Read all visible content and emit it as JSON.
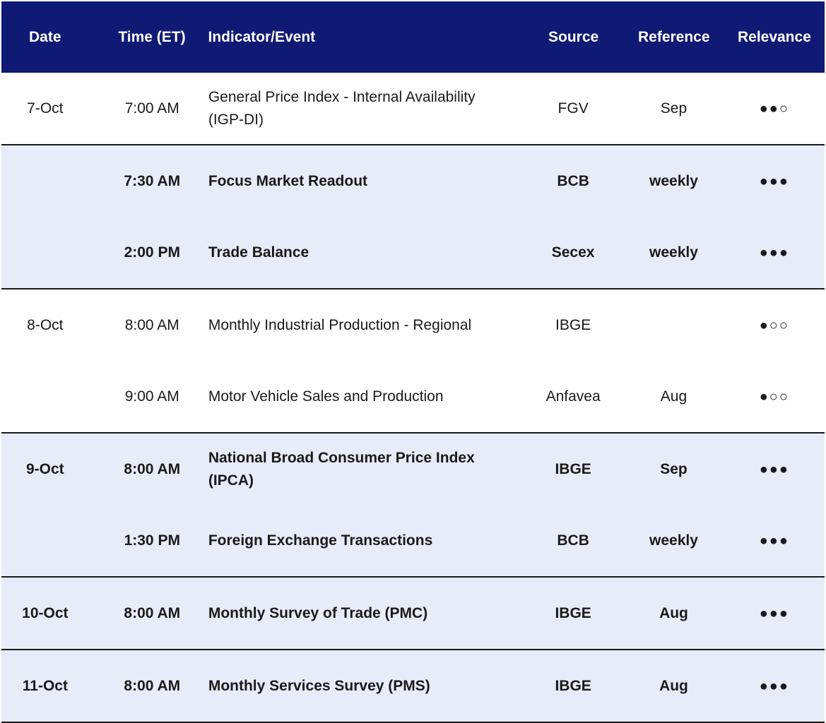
{
  "header": {
    "date": "Date",
    "time": "Time (ET)",
    "indicator": "Indicator/Event",
    "source": "Source",
    "reference": "Reference",
    "relevance": "Relevance"
  },
  "colors": {
    "header_bg": "#0f1a75",
    "shaded_bg": "#e6ecf8"
  },
  "groups": [
    {
      "shaded": false,
      "rows": [
        {
          "date": "7-Oct",
          "time": "7:00 AM",
          "indicator": "General Price Index - Internal Availability (IGP-DI)",
          "source": "FGV",
          "reference": "Sep",
          "relevance": "●●○",
          "bold": false
        }
      ]
    },
    {
      "shaded": true,
      "rows": [
        {
          "date": "",
          "time": "7:30 AM",
          "indicator": "Focus Market Readout",
          "source": "BCB",
          "reference": "weekly",
          "relevance": "●●●",
          "bold": true
        },
        {
          "date": "",
          "time": "2:00 PM",
          "indicator": "Trade Balance",
          "source": "Secex",
          "reference": "weekly",
          "relevance": "●●●",
          "bold": true
        }
      ]
    },
    {
      "shaded": false,
      "rows": [
        {
          "date": "8-Oct",
          "time": "8:00 AM",
          "indicator": "Monthly Industrial Production - Regional",
          "source": "IBGE",
          "reference": "",
          "relevance": "●○○",
          "bold": false
        },
        {
          "date": "",
          "time": "9:00 AM",
          "indicator": "Motor Vehicle Sales and Production",
          "source": "Anfavea",
          "reference": "Aug",
          "relevance": "●○○",
          "bold": false
        }
      ]
    },
    {
      "shaded": true,
      "rows": [
        {
          "date": "9-Oct",
          "time": "8:00 AM",
          "indicator": "National Broad Consumer Price Index (IPCA)",
          "source": "IBGE",
          "reference": "Sep",
          "relevance": "●●●",
          "bold": true
        },
        {
          "date": "",
          "time": "1:30 PM",
          "indicator": "Foreign Exchange Transactions",
          "source": "BCB",
          "reference": "weekly",
          "relevance": "●●●",
          "bold": true
        }
      ]
    },
    {
      "shaded": true,
      "rows": [
        {
          "date": "10-Oct",
          "time": "8:00 AM",
          "indicator": "Monthly Survey of Trade (PMC)",
          "source": "IBGE",
          "reference": "Aug",
          "relevance": "●●●",
          "bold": true
        }
      ]
    },
    {
      "shaded": true,
      "rows": [
        {
          "date": "11-Oct",
          "time": "8:00 AM",
          "indicator": "Monthly Services Survey (PMS)",
          "source": "IBGE",
          "reference": "Aug",
          "relevance": "●●●",
          "bold": true
        }
      ]
    }
  ]
}
